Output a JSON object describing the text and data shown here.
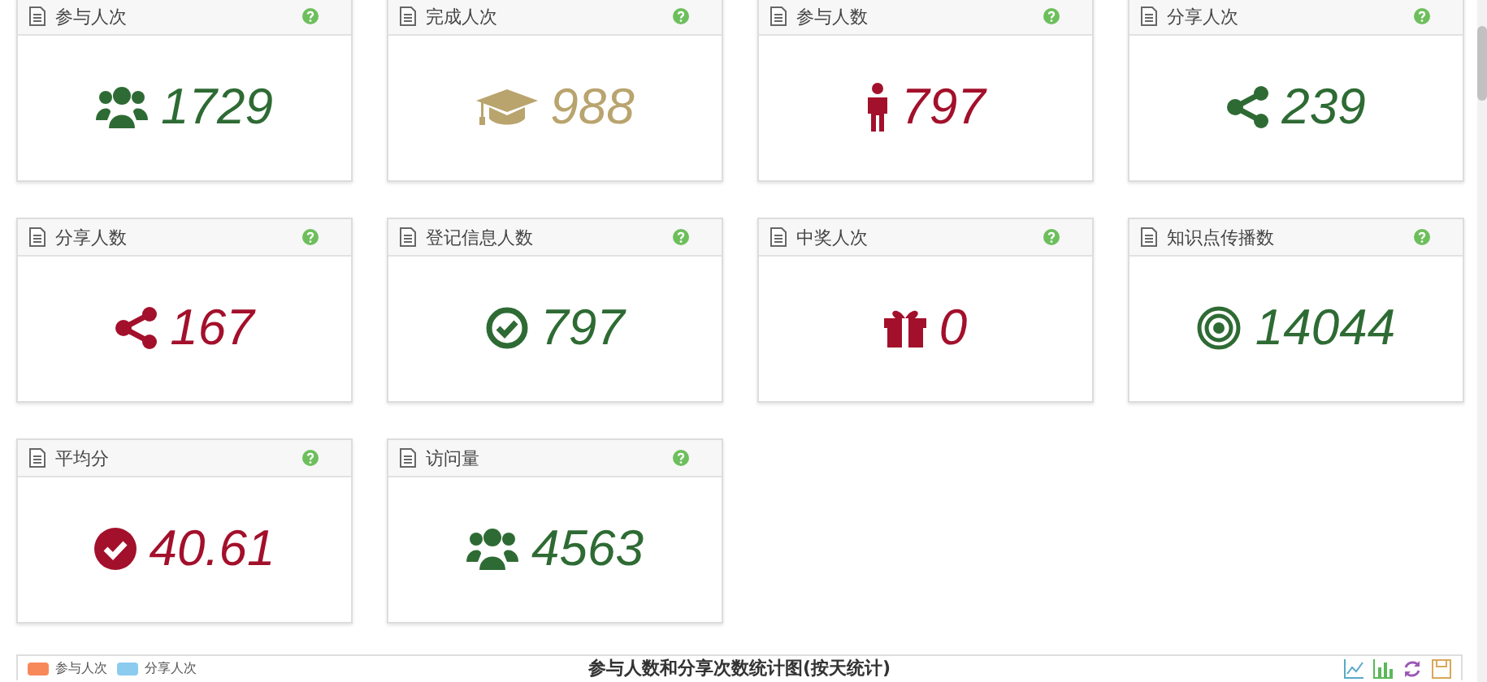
{
  "stats": [
    {
      "title": "参与人次",
      "value": "1729",
      "kind": "group",
      "color": "#2e6b34"
    },
    {
      "title": "完成人次",
      "value": "988",
      "kind": "graduation",
      "color": "#b9a46e"
    },
    {
      "title": "参与人数",
      "value": "797",
      "kind": "person",
      "color": "#a3102b"
    },
    {
      "title": "分享人次",
      "value": "239",
      "kind": "share",
      "color": "#2e6b34"
    },
    {
      "title": "分享人数",
      "value": "167",
      "kind": "share",
      "color": "#a3102b"
    },
    {
      "title": "登记信息人数",
      "value": "797",
      "kind": "check-outline",
      "color": "#2e6b34"
    },
    {
      "title": "中奖人次",
      "value": "0",
      "kind": "gift",
      "color": "#a3102b"
    },
    {
      "title": "知识点传播数",
      "value": "14044",
      "kind": "target",
      "color": "#2e6b34"
    },
    {
      "title": "平均分",
      "value": "40.61",
      "kind": "check-solid",
      "color": "#a3102b"
    },
    {
      "title": "访问量",
      "value": "4563",
      "kind": "group",
      "color": "#2e6b34"
    }
  ],
  "chart_panel": {
    "title": "参与人数和分享次数统计图(按天统计)",
    "legend": [
      {
        "label": "参与人次",
        "color": "#f7885a"
      },
      {
        "label": "分享人次",
        "color": "#8ccbf0"
      }
    ]
  }
}
